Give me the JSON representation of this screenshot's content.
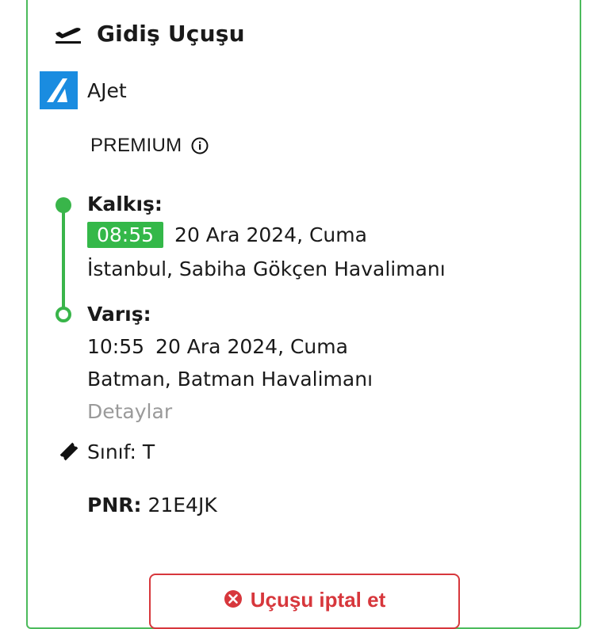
{
  "header": {
    "title": "Gidiş Uçuşu",
    "icon": "flight-takeoff-icon"
  },
  "airline": {
    "name": "AJet",
    "logo_color": "#1a8ce0"
  },
  "fare": {
    "label": "PREMIUM",
    "icon": "info-icon"
  },
  "departure": {
    "label": "Kalkış:",
    "time": "08:55",
    "date": "20 Ara 2024, Cuma",
    "airport": "İstanbul, Sabiha Gökçen Havalimanı"
  },
  "arrival": {
    "label": "Varış:",
    "time": "10:55",
    "date": "20 Ara 2024, Cuma",
    "airport": "Batman, Batman Havalimanı"
  },
  "details_link": "Detaylar",
  "class_info": "Sınıf: T",
  "pnr": {
    "label": "PNR:",
    "value": "21E4JK"
  },
  "cancel_button": {
    "label": "Uçuşu iptal et",
    "icon": "cancel-circle-icon"
  },
  "colors": {
    "accent_green": "#39b54a",
    "danger_red": "#d7373c",
    "border_green": "#4cbb5c"
  }
}
